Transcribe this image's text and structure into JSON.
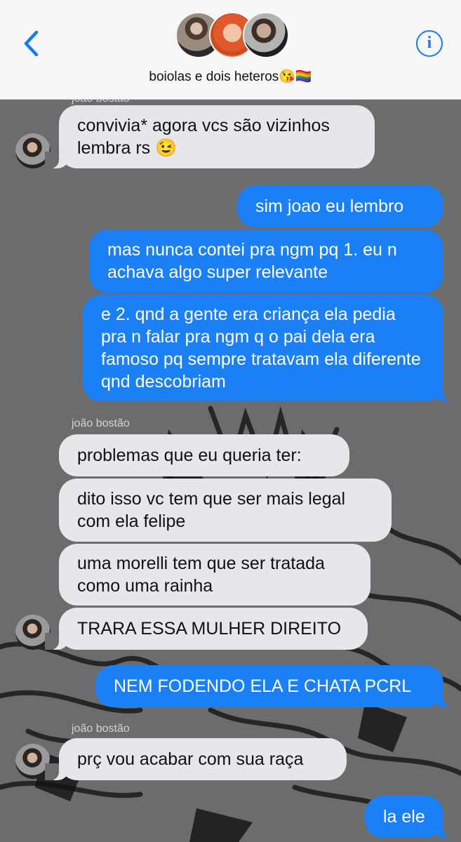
{
  "header": {
    "title": "boiolas e dois heteros😘🏳️‍🌈",
    "back_icon": "chevron-left-icon",
    "info_label": "i",
    "accent": "#1479f5"
  },
  "chat": {
    "sender_name": "joão bostão",
    "messages": [
      {
        "from": "in",
        "text": "convivia* agora vcs são vizinhos lembra rs 😉"
      },
      {
        "from": "out",
        "text": "sim joao eu lembro"
      },
      {
        "from": "out",
        "text": "mas nunca contei pra ngm pq 1. eu n achava algo super relevante"
      },
      {
        "from": "out",
        "text": "e 2. qnd a gente era criança ela pedia pra n falar pra ngm q o pai dela era famoso pq sempre tratavam ela diferente qnd descobriam"
      },
      {
        "from": "in",
        "text": "problemas que eu queria ter:"
      },
      {
        "from": "in",
        "text": "dito isso vc tem que ser mais legal com ela felipe"
      },
      {
        "from": "in",
        "text": "uma morelli tem que ser tratada como uma rainha"
      },
      {
        "from": "in",
        "text": "TRARA ESSA MULHER DIREITO"
      },
      {
        "from": "out",
        "text": "NEM FODENDO ELA E CHATA PCRL"
      },
      {
        "from": "in",
        "text": "prç vou acabar com sua raça"
      },
      {
        "from": "out",
        "text": "la ele"
      }
    ],
    "colors": {
      "incoming": "#e7e6eb",
      "outgoing": "#1b7ff6"
    }
  }
}
